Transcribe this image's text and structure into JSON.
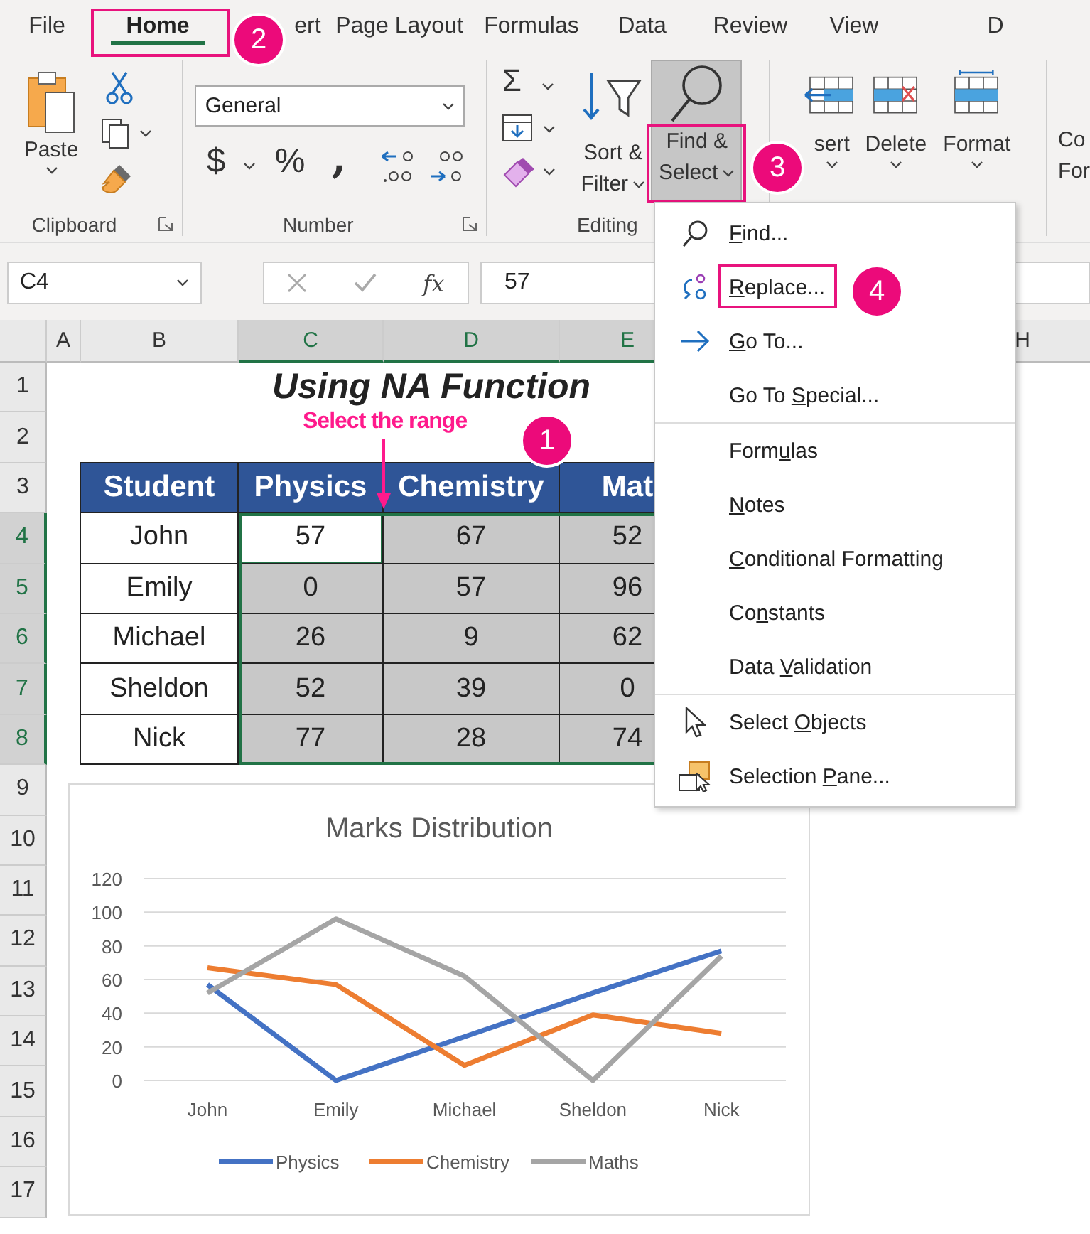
{
  "tabs": [
    {
      "label": "File",
      "selected": false,
      "highlighted": false
    },
    {
      "label": "Home",
      "selected": true,
      "highlighted": true
    },
    {
      "label": "ert",
      "selected": false,
      "highlighted": false
    },
    {
      "label": "Page Layout",
      "selected": false,
      "highlighted": false
    },
    {
      "label": "Formulas",
      "selected": false,
      "highlighted": false
    },
    {
      "label": "Data",
      "selected": false,
      "highlighted": false
    },
    {
      "label": "Review",
      "selected": false,
      "highlighted": false
    },
    {
      "label": "View",
      "selected": false,
      "highlighted": false
    },
    {
      "label": "D",
      "selected": false,
      "highlighted": false
    }
  ],
  "ribbon": {
    "clipboard": {
      "label": "Clipboard",
      "paste": "Paste"
    },
    "number": {
      "label": "Number",
      "format": "General",
      "currency": "$",
      "percent": "%",
      "comma": ","
    },
    "editing": {
      "label": "Editing",
      "sum": "Σ",
      "sort": [
        "Sort &",
        "Filter"
      ],
      "find": {
        "lines": [
          "Find &",
          "Select"
        ],
        "pressed": true,
        "highlighted": true
      }
    },
    "cells": {
      "buttons": [
        "sert",
        "Delete",
        "Format"
      ]
    },
    "cut": [
      "Co",
      "For"
    ]
  },
  "formula_bar": {
    "name_box": "C4",
    "fx": "fx",
    "value": "57"
  },
  "columns": [
    {
      "label": "A",
      "selected": false
    },
    {
      "label": "B",
      "selected": false
    },
    {
      "label": "C",
      "selected": true
    },
    {
      "label": "D",
      "selected": true
    },
    {
      "label": "E",
      "selected": true
    },
    {
      "label": "H",
      "selected": false
    }
  ],
  "rows": [
    {
      "label": "1",
      "selected": false
    },
    {
      "label": "2",
      "selected": false
    },
    {
      "label": "3",
      "selected": false
    },
    {
      "label": "4",
      "selected": true
    },
    {
      "label": "5",
      "selected": true
    },
    {
      "label": "6",
      "selected": true
    },
    {
      "label": "7",
      "selected": true
    },
    {
      "label": "8",
      "selected": true
    },
    {
      "label": "9",
      "selected": false
    },
    {
      "label": "10",
      "selected": false
    },
    {
      "label": "11",
      "selected": false
    },
    {
      "label": "12",
      "selected": false
    },
    {
      "label": "13",
      "selected": false
    },
    {
      "label": "14",
      "selected": false
    },
    {
      "label": "15",
      "selected": false
    },
    {
      "label": "16",
      "selected": false
    },
    {
      "label": "17",
      "selected": false
    }
  ],
  "title": "Using NA Function",
  "annotation": "Select the range",
  "table": {
    "headers": [
      "Student",
      "Physics",
      "Chemistry",
      "Mat"
    ],
    "rows": [
      {
        "student": "John",
        "cells": [
          {
            "text": "57",
            "selected": true,
            "active": true
          },
          {
            "text": "67",
            "selected": true,
            "active": false
          },
          {
            "text": "52",
            "selected": true,
            "active": false
          }
        ]
      },
      {
        "student": "Emily",
        "cells": [
          {
            "text": "0",
            "selected": true,
            "active": false
          },
          {
            "text": "57",
            "selected": true,
            "active": false
          },
          {
            "text": "96",
            "selected": true,
            "active": false
          }
        ]
      },
      {
        "student": "Michael",
        "cells": [
          {
            "text": "26",
            "selected": true,
            "active": false
          },
          {
            "text": "9",
            "selected": true,
            "active": false
          },
          {
            "text": "62",
            "selected": true,
            "active": false
          }
        ]
      },
      {
        "student": "Sheldon",
        "cells": [
          {
            "text": "52",
            "selected": true,
            "active": false
          },
          {
            "text": "39",
            "selected": true,
            "active": false
          },
          {
            "text": "0",
            "selected": true,
            "active": false
          }
        ]
      },
      {
        "student": "Nick",
        "cells": [
          {
            "text": "77",
            "selected": true,
            "active": false
          },
          {
            "text": "28",
            "selected": true,
            "active": false
          },
          {
            "text": "74",
            "selected": true,
            "active": false
          }
        ]
      }
    ]
  },
  "chart": {
    "chart_data": {
      "type": "line",
      "title": "Marks Distribution",
      "categories": [
        "John",
        "Emily",
        "Michael",
        "Sheldon",
        "Nick"
      ],
      "series": [
        {
          "name": "Physics",
          "color": "#4472c4",
          "values": [
            57,
            0,
            26,
            52,
            77
          ]
        },
        {
          "name": "Chemistry",
          "color": "#ed7d31",
          "values": [
            67,
            57,
            9,
            39,
            28
          ]
        },
        {
          "name": "Maths",
          "color": "#a5a5a5",
          "values": [
            52,
            96,
            62,
            0,
            74
          ]
        }
      ],
      "ylim": [
        0,
        120
      ],
      "yticks": [
        0,
        20,
        40,
        60,
        80,
        100,
        120
      ],
      "grid": true,
      "legend": true
    }
  },
  "menu": {
    "groups": [
      {
        "items": [
          {
            "kind": "find",
            "key": "F",
            "after": "ind...",
            "highlighted": false
          },
          {
            "kind": "replace",
            "key": "R",
            "after": "eplace...",
            "highlighted": true
          },
          {
            "kind": "goto",
            "key": "G",
            "after": "o To...",
            "highlighted": false
          },
          {
            "kind": "plain",
            "before": "Go To ",
            "key": "S",
            "after": "pecial...",
            "highlighted": false
          }
        ]
      },
      {
        "items": [
          {
            "kind": "plain",
            "before": "Form",
            "key": "u",
            "after": "las",
            "highlighted": false
          },
          {
            "kind": "plain",
            "key": "N",
            "after": "otes",
            "highlighted": false
          },
          {
            "kind": "plain",
            "key": "C",
            "after": "onditional Formatting",
            "highlighted": false
          },
          {
            "kind": "plain",
            "before": "Co",
            "key": "n",
            "after": "stants",
            "highlighted": false
          },
          {
            "kind": "plain",
            "before": "Data ",
            "key": "V",
            "after": "alidation",
            "highlighted": false
          }
        ]
      },
      {
        "items": [
          {
            "kind": "pointer",
            "before": "Select ",
            "key": "O",
            "after": "bjects",
            "highlighted": false
          },
          {
            "kind": "pane",
            "before": "Selection ",
            "key": "P",
            "after": "ane...",
            "highlighted": false
          }
        ]
      }
    ]
  },
  "callouts": [
    "1",
    "2",
    "3",
    "4"
  ]
}
